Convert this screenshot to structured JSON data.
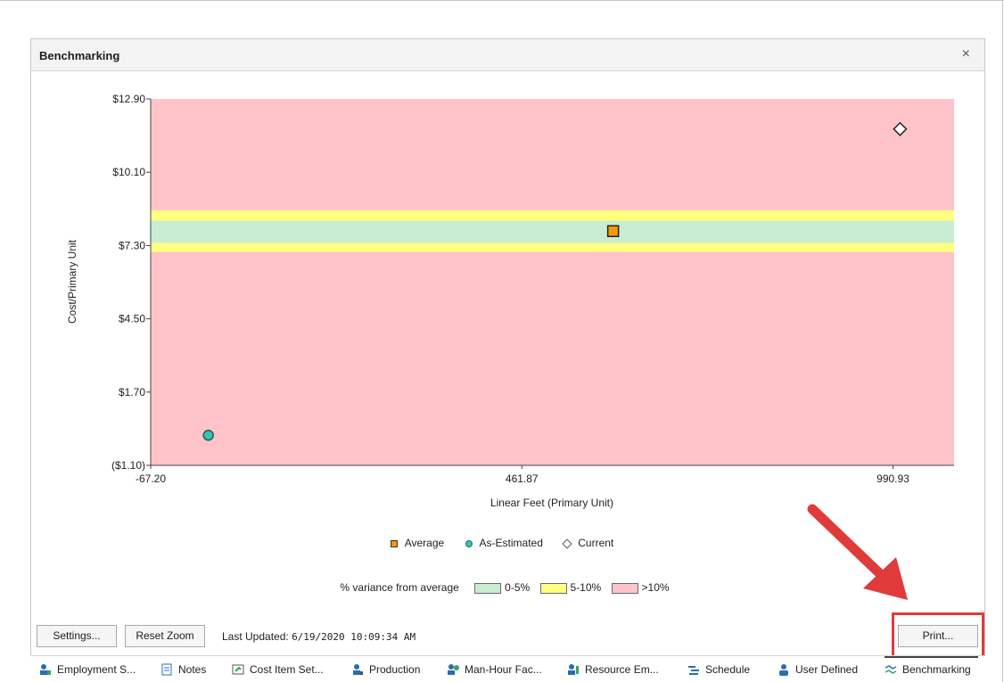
{
  "panel": {
    "title": "Benchmarking",
    "close_glyph": "×"
  },
  "chart_data": {
    "type": "scatter",
    "xlabel": "Linear Feet (Primary Unit)",
    "ylabel": "Cost/Primary Unit",
    "xlim": [
      -67.2,
      1078
    ],
    "ylim": [
      -1.1,
      12.9
    ],
    "x_ticks": [
      -67.2,
      461.87,
      990.93
    ],
    "x_tick_labels": [
      "-67.20",
      "461.87",
      "990.93"
    ],
    "y_ticks": [
      12.9,
      10.1,
      7.3,
      4.5,
      1.7,
      -1.1
    ],
    "y_tick_labels": [
      "$12.90",
      "$10.10",
      "$7.30",
      "$4.50",
      "$1.70",
      "($1.10)"
    ],
    "bands": [
      {
        "name": ">10%",
        "y0": -1.1,
        "y1": 12.9,
        "color": "#ffc3ca"
      },
      {
        "name": "5-10%",
        "y0": 7.05,
        "y1": 8.65,
        "color": "#ffff80"
      },
      {
        "name": "0-5%",
        "y0": 7.4,
        "y1": 8.25,
        "color": "#c9edd1"
      }
    ],
    "series": [
      {
        "name": "Average",
        "marker": "square",
        "color": "#f29a00",
        "points": [
          {
            "x": 592,
            "y": 7.85
          }
        ]
      },
      {
        "name": "As-Estimated",
        "marker": "circle",
        "color": "#36c3b4",
        "points": [
          {
            "x": 15,
            "y": 0.05
          }
        ]
      },
      {
        "name": "Current",
        "marker": "diamond",
        "color": "#ffffff",
        "points": [
          {
            "x": 1001,
            "y": 11.75
          }
        ]
      }
    ],
    "variance_label": "% variance from average",
    "variance_legend": [
      {
        "label": "0-5%",
        "color": "#c9edd1"
      },
      {
        "label": "5-10%",
        "color": "#ffff80"
      },
      {
        "label": ">10%",
        "color": "#ffc3ca"
      }
    ]
  },
  "toolbar": {
    "settings_label": "Settings...",
    "reset_zoom_label": "Reset Zoom",
    "last_updated_label": "Last Updated:",
    "last_updated_value": "6/19/2020 10:09:34 AM",
    "print_label": "Print..."
  },
  "tabs": [
    {
      "label": "Employment S...",
      "icon": "employment-icon"
    },
    {
      "label": "Notes",
      "icon": "notes-icon"
    },
    {
      "label": "Cost Item Set...",
      "icon": "cost-item-icon"
    },
    {
      "label": "Production",
      "icon": "production-icon"
    },
    {
      "label": "Man-Hour Fac...",
      "icon": "man-hour-icon"
    },
    {
      "label": "Resource Em...",
      "icon": "resource-icon"
    },
    {
      "label": "Schedule",
      "icon": "schedule-icon"
    },
    {
      "label": "User Defined",
      "icon": "user-icon"
    },
    {
      "label": "Benchmarking",
      "icon": "benchmarking-icon"
    }
  ],
  "colors": {
    "highlight": "#e03a3a",
    "arrow": "#e03a3a"
  }
}
